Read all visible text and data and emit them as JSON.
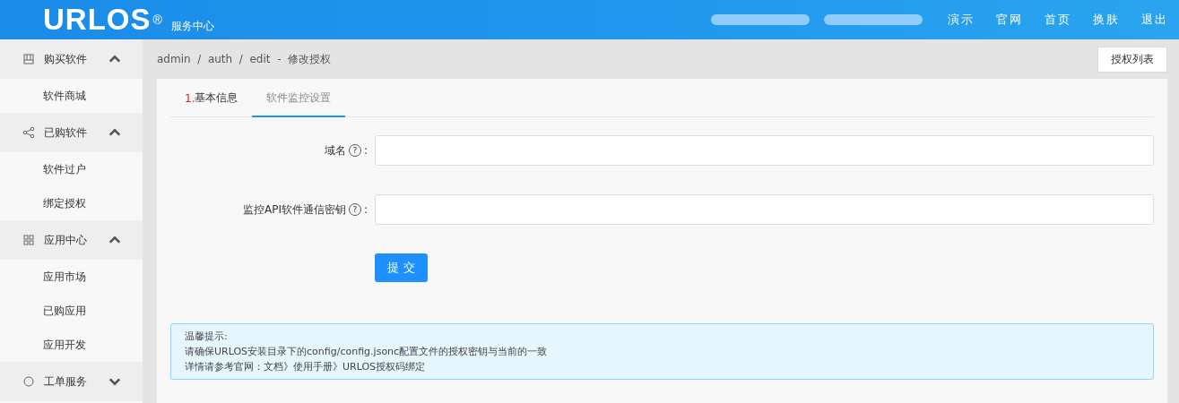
{
  "header": {
    "logo": "URLOS",
    "logo_mark": "®",
    "subtitle": "服务中心",
    "nav": [
      "演示",
      "官网",
      "首页",
      "换肤",
      "退出"
    ]
  },
  "sidebar": {
    "groups": [
      {
        "label": "购买软件",
        "expanded": true,
        "items": [
          "软件商城"
        ]
      },
      {
        "label": "已购软件",
        "expanded": true,
        "items": [
          "软件过户",
          "绑定授权"
        ]
      },
      {
        "label": "应用中心",
        "expanded": true,
        "items": [
          "应用市场",
          "已购应用",
          "应用开发"
        ]
      },
      {
        "label": "工单服务",
        "expanded": false
      }
    ]
  },
  "breadcrumb": "admin  /  auth  /  edit  -  修改授权",
  "list_button": "授权列表",
  "tabs": [
    {
      "prefix": "1.",
      "label": "基本信息",
      "selected": false
    },
    {
      "label": "软件监控设置",
      "selected": true
    }
  ],
  "form": {
    "fields": [
      {
        "label": "域名",
        "help": "?",
        "colon": ":"
      },
      {
        "label": "监控API软件通信密钥",
        "help": "?",
        "colon": ":"
      }
    ],
    "submit": "提 交"
  },
  "notice": [
    "温馨提示:",
    "请确保URLOS安装目录下的config/config.jsonc配置文件的授权密钥与当前的一致",
    "详情请参考官网：文档》使用手册》URLOS授权码绑定"
  ]
}
